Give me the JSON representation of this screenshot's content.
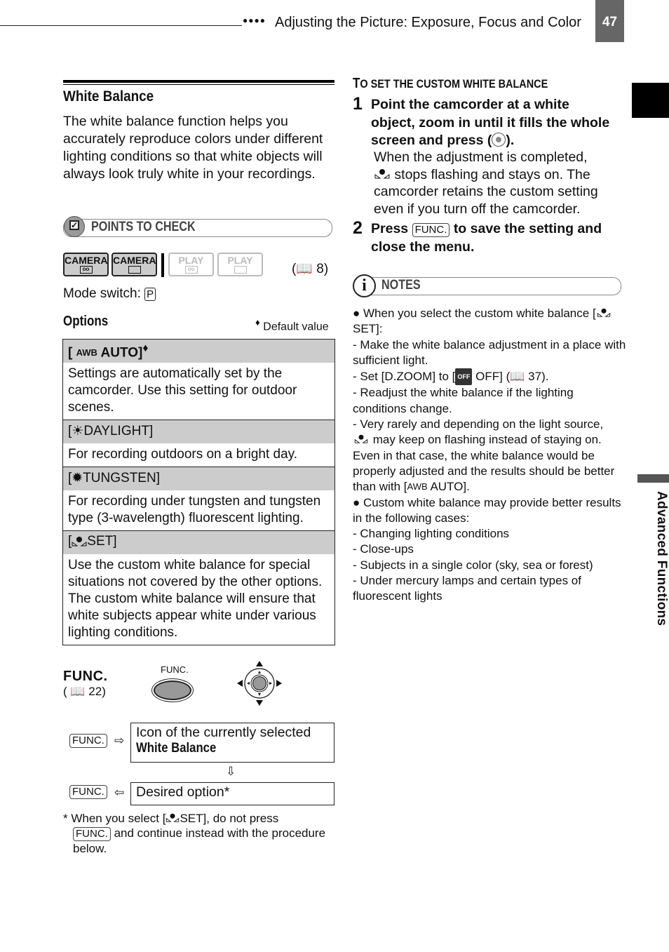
{
  "header": {
    "dots": "●●●●",
    "title": "Adjusting the Picture: Exposure, Focus and Color",
    "page_number": "47",
    "side_tab": "Advanced Functions"
  },
  "section": {
    "title": "White Balance",
    "intro": "The white balance function helps you accurately reproduce colors under different lighting conditions so that white objects will always look truly white in your recordings."
  },
  "points_to_check": {
    "label": "POINTS TO CHECK",
    "modes": [
      {
        "label": "CAMERA",
        "media": "tape",
        "active": true
      },
      {
        "label": "CAMERA",
        "media": "card",
        "active": true
      },
      {
        "label": "PLAY",
        "media": "tape",
        "active": false
      },
      {
        "label": "PLAY",
        "media": "card",
        "active": false
      }
    ],
    "ref": "8",
    "mode_switch_label": "Mode switch:",
    "mode_switch_value": "P"
  },
  "options": {
    "heading": "Options",
    "default_marker": "♦",
    "default_label": "Default value",
    "items": [
      {
        "icon": "AWB",
        "name": "AUTO",
        "is_default": true,
        "description": "Settings are automatically set by the camcorder. Use this setting for outdoor scenes."
      },
      {
        "icon": "☀",
        "name": "DAYLIGHT",
        "is_default": false,
        "description": "For recording outdoors on a bright day."
      },
      {
        "icon": "✹",
        "name": "TUNGSTEN",
        "is_default": false,
        "description": "For recording under tungsten and tungsten type (3-wavelength) fluorescent lighting."
      },
      {
        "icon": "custom-wb",
        "name": "SET",
        "is_default": false,
        "description": "Use the custom white balance for special situations not covered by the other options. The custom white balance will ensure that white subjects appear white under various lighting conditions."
      }
    ]
  },
  "func_diagram": {
    "heading": "FUNC.",
    "ref": "22",
    "button_label": "FUNC.",
    "key_label": "FUNC.",
    "box1_line1": "Icon of the currently selected",
    "box1_line2": "White Balance",
    "box2": "Desired option*",
    "footnote_a": "* When you select [",
    "footnote_b": "SET], do not press",
    "footnote_c": "and continue instead with the procedure below."
  },
  "procedure": {
    "title_cap": "T",
    "title_rest": "O SET THE CUSTOM WHITE BALANCE",
    "steps": [
      {
        "num": "1",
        "title_a": "Point the camcorder at a white object, zoom in until it fills the whole screen and press (",
        "title_b": ").",
        "detail_a": "When the adjustment is completed,",
        "detail_b": "stops flashing and stays on. The camcorder retains the custom setting even if you turn off the camcorder."
      },
      {
        "num": "2",
        "title_a": "Press",
        "key": "FUNC.",
        "title_b": "to save the setting and close the menu."
      }
    ]
  },
  "notes": {
    "label": "NOTES",
    "b1": "● When you select the custom white balance [",
    "b1_end": "SET]:",
    "l1": "-  Make the white balance adjustment in a place with sufficient light.",
    "l2a": "-  Set [D.ZOOM] to [",
    "l2_badge": "OFF",
    "l2b": "OFF] (",
    "l2_ref": "37).",
    "l3": "-  Readjust the white balance if the lighting conditions change.",
    "l4a": "-  Very rarely and depending on the light source,",
    "l4b": "may keep on flashing instead of staying on. Even in that case, the white balance would be properly adjusted and the results should be better than with [",
    "l4c": "AUTO].",
    "b2": "● Custom white balance may provide better results in the following cases:",
    "cases": [
      "-  Changing lighting conditions",
      "-  Close-ups",
      "-  Subjects in a single color (sky, sea or forest)",
      "-  Under mercury lamps and certain types of fluorescent lights"
    ]
  },
  "colors": {
    "page_tab": "#666666",
    "option_header": "#cccccc",
    "side_black_tab": "#000000"
  }
}
